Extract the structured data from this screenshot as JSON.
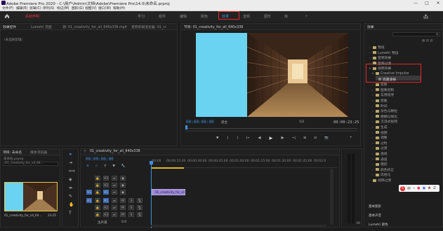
{
  "window": {
    "title": "Adobe Premiere Pro 2020 - C:\\用户\\Admin\\文档\\Adobe\\Premiere Pro\\14.0\\未命名.prproj",
    "controls": [
      "—",
      "□",
      "✕"
    ]
  },
  "menu": [
    "文件(F)",
    "编辑(E)",
    "剪辑(C)",
    "序列(S)",
    "标记(M)",
    "图形(G)",
    "视图(V)",
    "窗口(W)",
    "帮助(H)"
  ],
  "workspaces": {
    "first": "系统声明",
    "items": [
      "学习",
      "组件",
      "编辑",
      "颜色",
      "效果",
      "音频",
      "图形",
      "库"
    ],
    "overflow": "»"
  },
  "source_panel": {
    "tabs": [
      "效果控件",
      "Lumetri 范围",
      "源: 01_creativity_for_all_640x338.mp4",
      "音频剪辑混合器: 01_cr"
    ],
    "empty_text": "(未选择剪辑)"
  },
  "program_panel": {
    "tab": "节目: 01_creativity_for_all_640x338",
    "timecode_left": "00:00:00:00",
    "fit": "适合",
    "quality": "1/2",
    "timecode_right": "00:00:23:25",
    "controls": [
      "▼",
      "{",
      "}",
      "|←",
      "◀|",
      "▶",
      "|▶",
      "→|",
      "⊞",
      "⊡",
      "📷",
      "+"
    ]
  },
  "project_panel": {
    "tabs": [
      "项目: 未命名",
      "媒体浏览器"
    ],
    "file_label": "未命名.prproj",
    "item_label": "01_creativity_for_all_64...",
    "item_name": "01_creativity_for_all_64...",
    "item_duration": "23:25"
  },
  "timeline": {
    "tab": "01_creativity_for_all_640x338",
    "timecode": "00:00:00:00",
    "ruler": [
      ":00:00",
      "00:00:15:00",
      "00:00:30:00",
      "00:00:45:00",
      "00:01:00:00",
      "00:01:15:00",
      "00:01:30:00",
      "00:01:45:00",
      "00:02:0"
    ],
    "video_tracks": [
      "V3",
      "V2",
      "V1"
    ],
    "audio_tracks": [
      "A1",
      "A2",
      "A3"
    ],
    "clip_label": "01_creativity_for_all",
    "master": "主声道",
    "master_value": "0.0"
  },
  "effects_panel": {
    "tab": "效果",
    "items": [
      {
        "label": "预设",
        "level": 0,
        "open": false
      },
      {
        "label": "Lumetri 预设",
        "level": 0,
        "open": false
      },
      {
        "label": "音频效果",
        "level": 0,
        "open": false
      },
      {
        "label": "音频过渡",
        "level": 0,
        "open": false
      },
      {
        "label": "视频效果",
        "level": 0,
        "open": true
      },
      {
        "label": "Creative Impulse",
        "level": 1,
        "open": true
      },
      {
        "label": "完美涂抹",
        "level": 2,
        "open": false,
        "selected": true
      },
      {
        "label": "变换",
        "level": 1,
        "open": false
      },
      {
        "label": "图像控制",
        "level": 1,
        "open": false
      },
      {
        "label": "实用程序",
        "level": 1,
        "open": false
      },
      {
        "label": "扭曲",
        "level": 1,
        "open": false
      },
      {
        "label": "时间",
        "level": 1,
        "open": false
      },
      {
        "label": "杂色与颗粒",
        "level": 1,
        "open": false
      },
      {
        "label": "模糊与锐化",
        "level": 1,
        "open": false
      },
      {
        "label": "沉浸式视频",
        "level": 1,
        "open": false
      },
      {
        "label": "生成",
        "level": 1,
        "open": false
      },
      {
        "label": "视频",
        "level": 1,
        "open": false
      },
      {
        "label": "调整",
        "level": 1,
        "open": false
      },
      {
        "label": "过时",
        "level": 1,
        "open": false
      },
      {
        "label": "过渡",
        "level": 1,
        "open": false
      },
      {
        "label": "透视",
        "level": 1,
        "open": false
      },
      {
        "label": "通道",
        "level": 1,
        "open": false
      },
      {
        "label": "键控",
        "level": 1,
        "open": false
      },
      {
        "label": "颜色校正",
        "level": 1,
        "open": false
      },
      {
        "label": "风格化",
        "level": 1,
        "open": false
      },
      {
        "label": "视频过渡",
        "level": 0,
        "open": false
      }
    ],
    "sub_panels": [
      "基本图形",
      "基本声音",
      "Lumetri 颜色"
    ]
  },
  "colors": {
    "highlight_red": "#e8262a",
    "accent_blue": "#3d8ee4",
    "clip_purple": "#9b88d6",
    "preview_cyan": "#6ad3f2"
  }
}
